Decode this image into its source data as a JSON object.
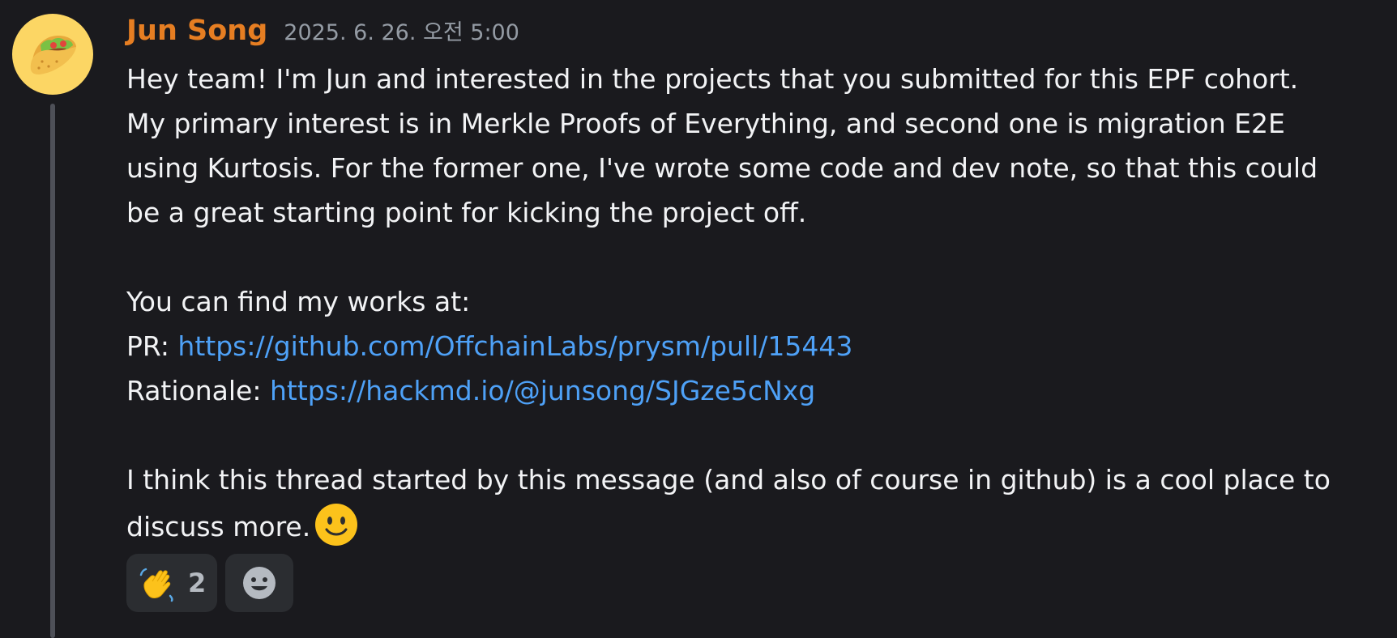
{
  "author": {
    "name": "Jun Song",
    "timestamp": "2025. 6. 26. 오전 5:00",
    "avatar_icon": "taco-icon",
    "name_color": "#e67e22"
  },
  "message": {
    "para1": [
      "Hey team! I'm Jun and interested in the projects that you submitted for this EPF cohort.",
      "My primary interest is in Merkle Proofs of Everything, and second one is migration E2E",
      "using Kurtosis. For the former one, I've wrote some code and dev note, so that this could",
      "be a great starting point for kicking the project off."
    ],
    "works_intro": "You can find my works at:",
    "pr_label": "PR: ",
    "pr_link": "https://github.com/OffchainLabs/prysm/pull/15443",
    "rationale_label": "Rationale: ",
    "rationale_link": "https://hackmd.io/@junsong/SJGze5cNxg",
    "para3": [
      "I think this thread started by this message (and also of course in github) is a cool place to",
      "discuss more."
    ],
    "trailing_emoji": "slightly-smiling-face-icon",
    "link_color": "#4ea1f7"
  },
  "reactions": [
    {
      "emoji": "waving-hand-icon",
      "count": "2"
    }
  ],
  "add_reaction_icon": "add-reaction-smiley-icon"
}
